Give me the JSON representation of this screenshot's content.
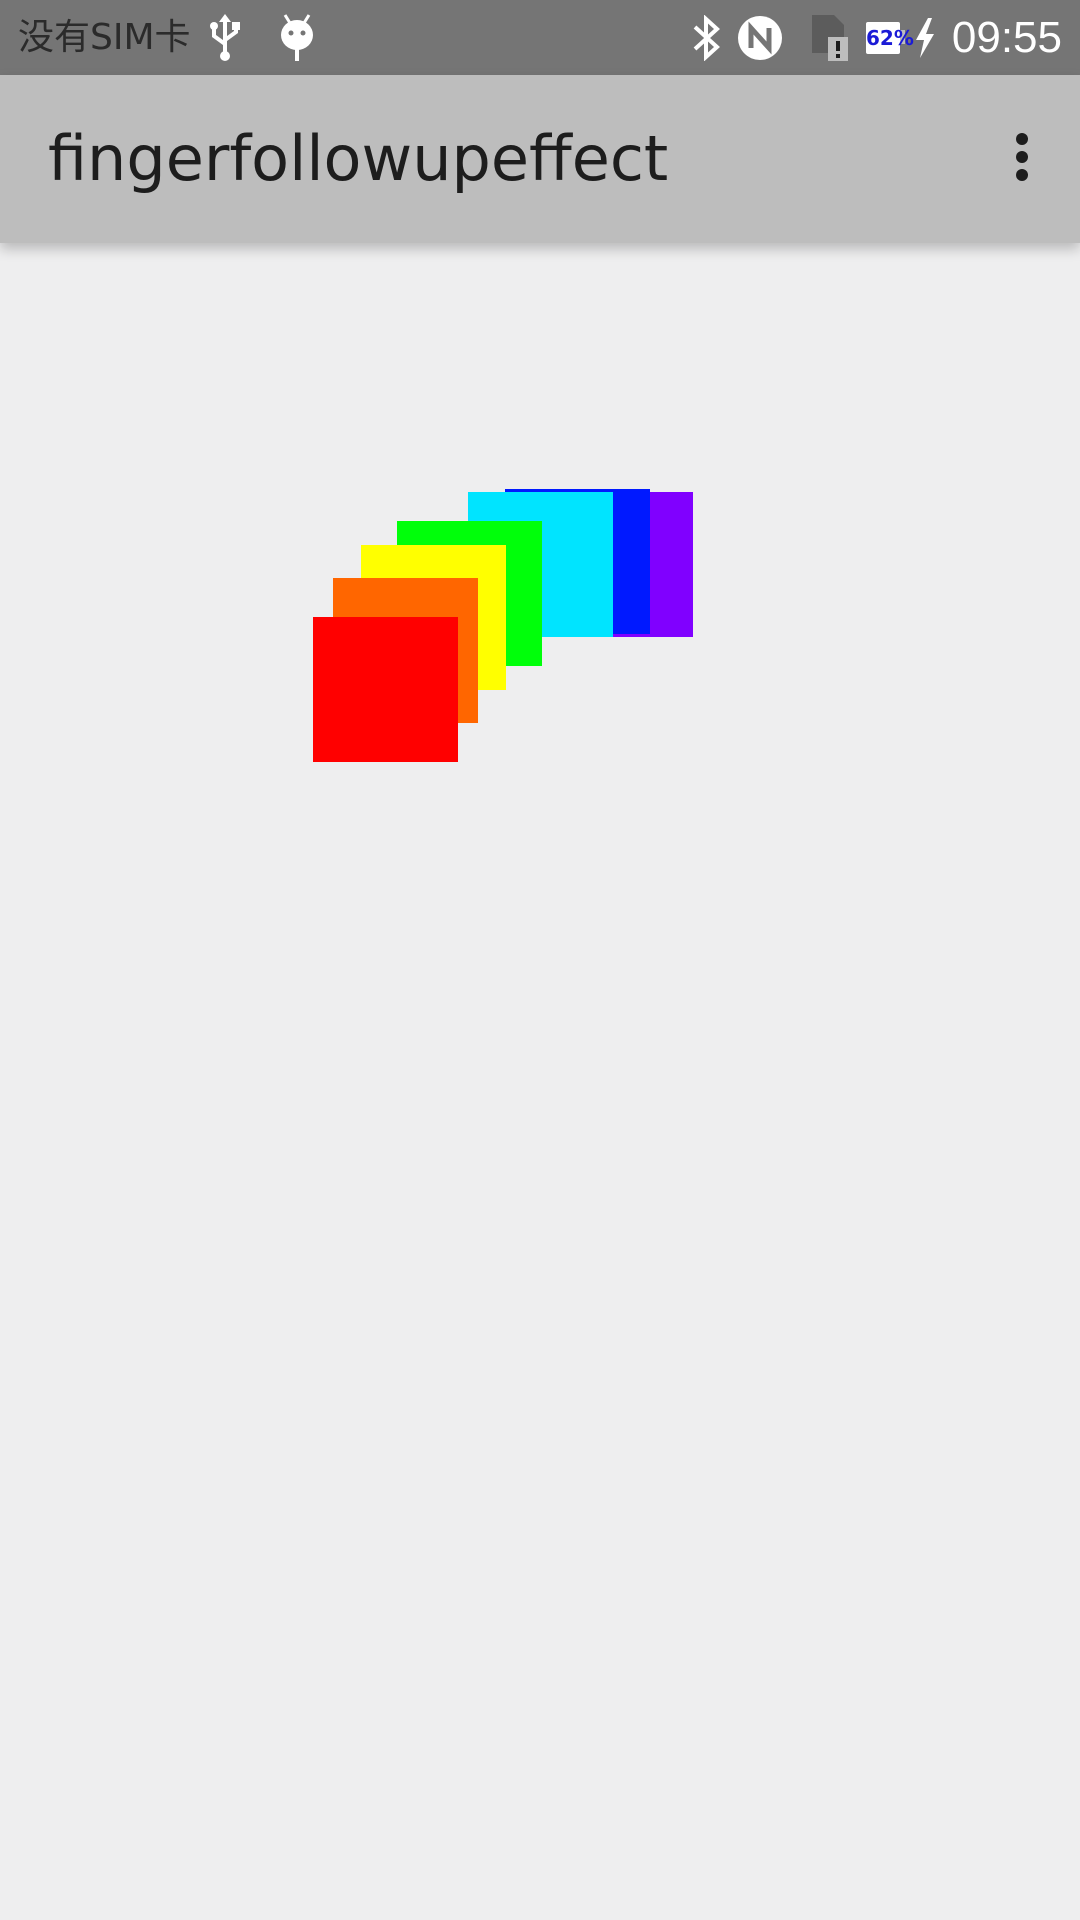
{
  "status_bar": {
    "carrier": "没有SIM卡",
    "battery_level": "62%",
    "time": "09:55",
    "icons": [
      "usb-icon",
      "android-debug-icon",
      "bluetooth-icon",
      "nfc-icon",
      "sim-alert-icon",
      "battery-icon",
      "charging-icon"
    ]
  },
  "app_bar": {
    "title": "fingerfollowupeffect",
    "overflow_icon": "more-vert-icon"
  },
  "colors": {
    "status_bar_bg": "#757575",
    "app_bar_bg": "#bdbdbd",
    "content_bg": "#eeeeef",
    "squares": [
      "#8000ff",
      "#0019ff",
      "#00e4ff",
      "#00ff0a",
      "#ffff00",
      "#ff6600",
      "#ff0000"
    ]
  }
}
